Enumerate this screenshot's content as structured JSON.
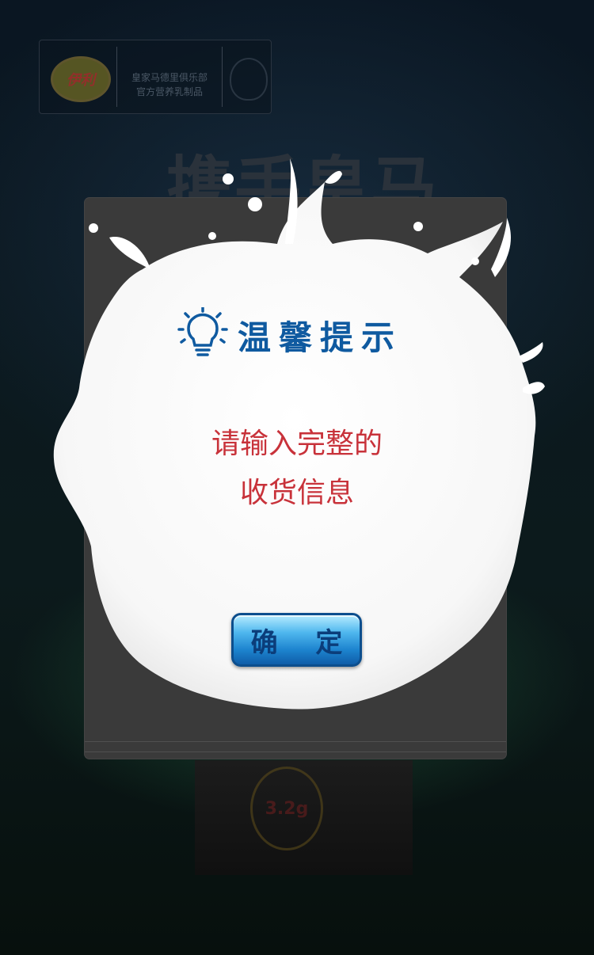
{
  "brand": {
    "logo_text": "伊利",
    "club_line1": "皇家马德里俱乐部",
    "club_line2": "官方营养乳制品",
    "headline": "携手皇马"
  },
  "product": {
    "badge": "3.2g"
  },
  "dialog": {
    "title": "温馨提示",
    "message_line1": "请输入完整的",
    "message_line2": "收货信息",
    "confirm_label": "确 定"
  },
  "colors": {
    "title": "#0f5aa0",
    "message": "#c8323a",
    "button": "#1d84cf"
  }
}
